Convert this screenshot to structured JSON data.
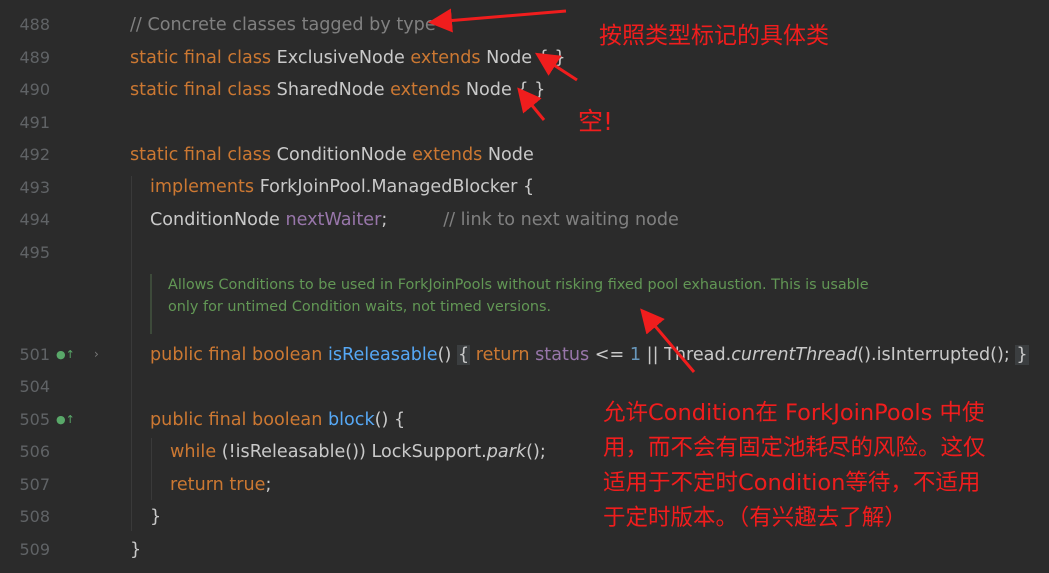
{
  "editor": {
    "lines": [
      {
        "num": "488"
      },
      {
        "num": "489"
      },
      {
        "num": "490"
      },
      {
        "num": "491"
      },
      {
        "num": "492"
      },
      {
        "num": "493"
      },
      {
        "num": "494"
      },
      {
        "num": "495"
      },
      {
        "num": "501"
      },
      {
        "num": "504"
      },
      {
        "num": "505"
      },
      {
        "num": "506"
      },
      {
        "num": "507"
      },
      {
        "num": "508"
      },
      {
        "num": "509"
      }
    ],
    "code": {
      "l488": "// Concrete classes tagged by type",
      "l489": {
        "kw": "static final class",
        "name": "ExclusiveNode",
        "ext": "extends",
        "base": "Node { }"
      },
      "l490": {
        "kw": "static final class",
        "name": "SharedNode",
        "ext": "extends",
        "base": "Node { }"
      },
      "l492": {
        "kw": "static final class",
        "name": "ConditionNode",
        "ext": "extends",
        "base": "Node"
      },
      "l493": {
        "kw": "implements",
        "rest": "ForkJoinPool.ManagedBlocker {"
      },
      "l494": {
        "type": "ConditionNode",
        "field": "nextWaiter",
        "semi": ";",
        "comment": "// link to next waiting node"
      },
      "doc": [
        "Allows Conditions to be used in ForkJoinPools without risking fixed pool exhaustion. This is usable",
        "only for untimed Condition waits, not timed versions."
      ],
      "l501": {
        "kw": "public final boolean",
        "method": "isReleasable",
        "paren": "()",
        "open": "{",
        "ret": "return",
        "field": "status",
        "op": "<=",
        "num": "1",
        "or": "||",
        "cls": "Thread.",
        "call": "currentThread",
        "tail": "().isInterrupted();",
        "close": "}"
      },
      "l505": {
        "kw": "public final boolean",
        "method": "block",
        "tail": "() {"
      },
      "l506": {
        "kw": "while",
        "mid": "(!isReleasable()) LockSupport.",
        "call": "park",
        "tail": "();"
      },
      "l507": {
        "kw": "return",
        "val": "true",
        "semi": ";"
      },
      "l508": "}",
      "l509": "}"
    }
  },
  "annotations": {
    "title": "按照类型标记的具体类",
    "empty": "空!",
    "explain": [
      "允许Condition在 ForkJoinPools 中使",
      "用，而不会有固定池耗尽的风险。这仅",
      "适用于不定时Condition等待，不适用",
      "于定时版本。（有兴趣去了解）"
    ]
  },
  "colors": {
    "background": "#2b2b2b",
    "keyword": "#cc7832",
    "field": "#9876aa",
    "method": "#56a8f5",
    "number": "#6897bb",
    "comment": "#808080",
    "doc": "#629755",
    "annotation": "#f01d1d"
  },
  "icons": {
    "override": "override-marker-icon",
    "fold": "chevron-right-icon"
  }
}
